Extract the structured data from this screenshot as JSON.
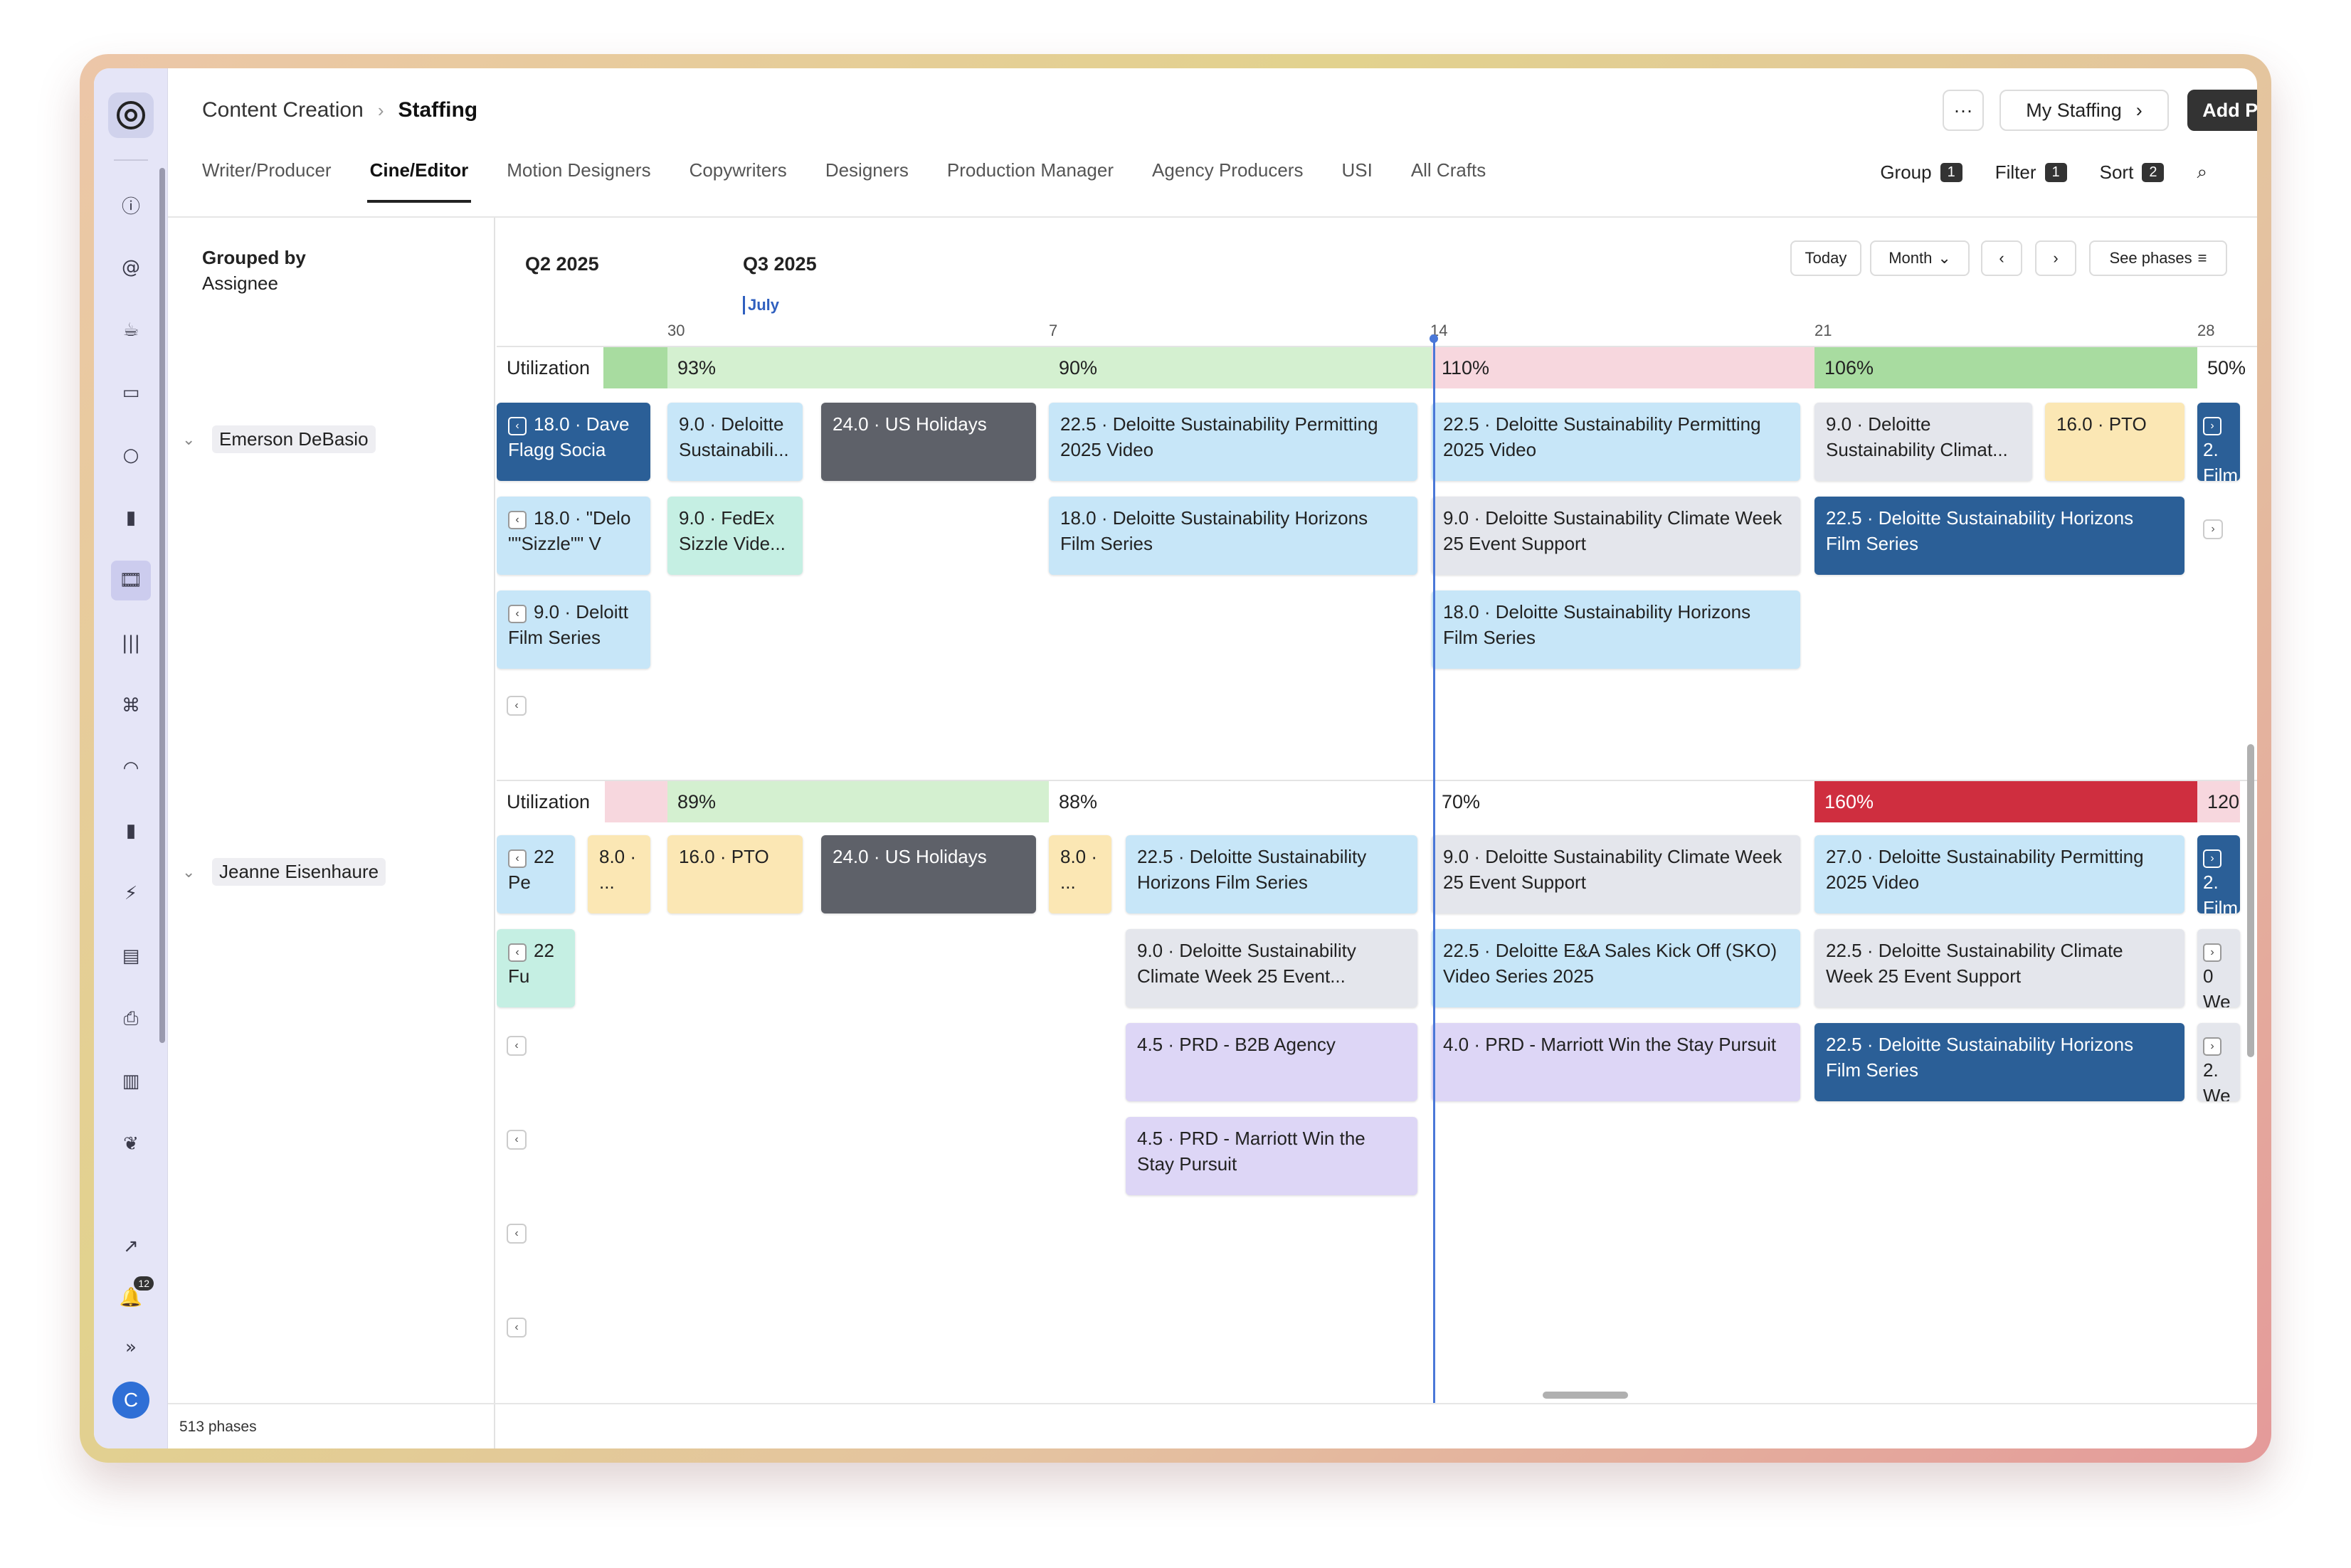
{
  "breadcrumb": {
    "parent": "Content Creation",
    "current": "Staffing"
  },
  "header_actions": {
    "more": "···",
    "my_staffing": "My Staffing",
    "add_phase": "Add Phase"
  },
  "tabs": [
    {
      "label": "Writer/Producer"
    },
    {
      "label": "Cine/Editor"
    },
    {
      "label": "Motion Designers"
    },
    {
      "label": "Copywriters"
    },
    {
      "label": "Designers"
    },
    {
      "label": "Production Manager"
    },
    {
      "label": "Agency Producers"
    },
    {
      "label": "USI"
    },
    {
      "label": "All Crafts"
    }
  ],
  "tools": {
    "group": {
      "label": "Group",
      "count": "1"
    },
    "filter": {
      "label": "Filter",
      "count": "1"
    },
    "sort": {
      "label": "Sort",
      "count": "2"
    }
  },
  "grouped_by": {
    "title": "Grouped by",
    "value": "Assignee"
  },
  "timeline": {
    "quarters": [
      "Q2 2025",
      "Q3 2025"
    ],
    "month": "July",
    "days": [
      "30",
      "7",
      "14",
      "21",
      "28"
    ],
    "controls": {
      "today": "Today",
      "month": "Month",
      "see_phases": "See phases"
    }
  },
  "assignees": [
    {
      "name": "Emerson DeBasio",
      "utilization_label": "Utilization",
      "utilization": [
        "93%",
        "90%",
        "110%",
        "106%",
        "50%"
      ],
      "cards": [
        {
          "text": "18.0 · Dave Flagg Socia"
        },
        {
          "text": "9.0 · Deloitte Sustainabili..."
        },
        {
          "text": "24.0 · US Holidays"
        },
        {
          "text": "22.5 · Deloitte Sustainability Permitting 2025 Video"
        },
        {
          "text": "22.5 · Deloitte Sustainability Permitting 2025 Video"
        },
        {
          "text": "9.0 · Deloitte Sustainability Climat..."
        },
        {
          "text": "16.0 · PTO"
        },
        {
          "text": "2. Film"
        },
        {
          "text": "18.0 · \"Delo \"\"Sizzle\"\" V"
        },
        {
          "text": "9.0 · FedEx Sizzle Vide..."
        },
        {
          "text": "18.0 · Deloitte Sustainability Horizons Film Series"
        },
        {
          "text": "9.0 · Deloitte Sustainability Climate Week 25 Event Support"
        },
        {
          "text": "22.5 · Deloitte Sustainability Horizons Film Series"
        },
        {
          "text": "9.0 · Deloitt Film Series"
        },
        {
          "text": "18.0 · Deloitte Sustainability Horizons Film Series"
        }
      ]
    },
    {
      "name": "Jeanne Eisenhaure",
      "utilization_label": "Utilization",
      "utilization": [
        "89%",
        "88%",
        "70%",
        "160%",
        "120"
      ],
      "cards": [
        {
          "text": "22 Pe"
        },
        {
          "text": "8.0 · ..."
        },
        {
          "text": "16.0 · PTO"
        },
        {
          "text": "24.0 · US Holidays"
        },
        {
          "text": "8.0 · ..."
        },
        {
          "text": "22.5 · Deloitte Sustainability Horizons Film Series"
        },
        {
          "text": "9.0 · Deloitte Sustainability Climate Week 25 Event Support"
        },
        {
          "text": "27.0 · Deloitte Sustainability Permitting 2025 Video"
        },
        {
          "text": "2. Film"
        },
        {
          "text": "22 Fu"
        },
        {
          "text": "9.0 · Deloitte Sustainability Climate Week 25 Event..."
        },
        {
          "text": "22.5 · Deloitte E&A Sales Kick Off (SKO) Video Series 2025"
        },
        {
          "text": "22.5 · Deloitte Sustainability Climate Week 25 Event Support"
        },
        {
          "text": "0 We"
        },
        {
          "text": "4.5 · PRD - B2B Agency"
        },
        {
          "text": "4.0 · PRD - Marriott Win the Stay Pursuit"
        },
        {
          "text": "22.5 · Deloitte Sustainability Horizons Film Series"
        },
        {
          "text": "2. We"
        },
        {
          "text": "4.5 · PRD - Marriott Win the Stay Pursuit"
        }
      ]
    }
  ],
  "footer": {
    "phase_count": "513 phases"
  },
  "sidebar": {
    "notification_count": "12",
    "avatar_initial": "C"
  },
  "colors": {
    "accent": "#2b5f97",
    "over_util": "#cf2e3f",
    "good_util": "#d4f0d0",
    "warn_util": "#f7d7de"
  }
}
